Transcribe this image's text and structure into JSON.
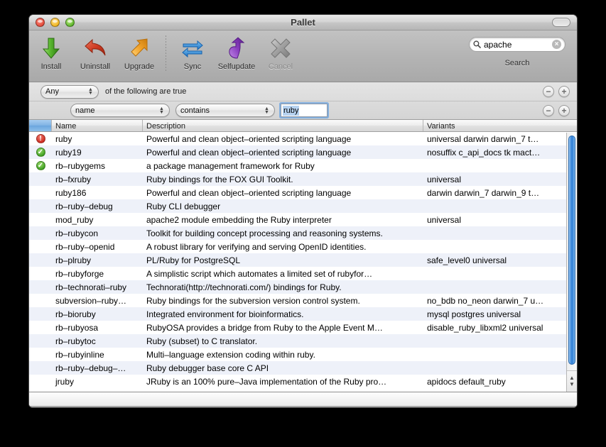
{
  "window": {
    "title": "Pallet",
    "traffic_lights": [
      "close",
      "minimize",
      "zoom"
    ],
    "toolbar_toggle": "toolbar-toggle-button"
  },
  "toolbar": {
    "items": [
      {
        "label": "Install",
        "icon": "down-arrow-icon",
        "enabled": true
      },
      {
        "label": "Uninstall",
        "icon": "back-arrow-icon",
        "enabled": true
      },
      {
        "label": "Upgrade",
        "icon": "up-arrow-icon",
        "enabled": true
      },
      {
        "label": "Sync",
        "icon": "sync-arrows-icon",
        "enabled": true
      },
      {
        "label": "Selfupdate",
        "icon": "curved-up-arrow-icon",
        "enabled": true
      },
      {
        "label": "Cancel",
        "icon": "x-cross-icon",
        "enabled": false
      }
    ],
    "search": {
      "value": "apache",
      "placeholder": "Search",
      "label": "Search",
      "icon": "search-icon",
      "clear_icon": "clear-icon"
    }
  },
  "filters": {
    "match_popup": "Any",
    "caption": "of the following are true",
    "rules": [
      {
        "field": "name",
        "operator": "contains",
        "value": "ruby"
      }
    ],
    "remove_label": "−",
    "add_label": "+"
  },
  "table": {
    "columns": [
      {
        "key": "status",
        "label": ""
      },
      {
        "key": "name",
        "label": "Name"
      },
      {
        "key": "description",
        "label": "Description"
      },
      {
        "key": "variants",
        "label": "Variants"
      }
    ],
    "rows": [
      {
        "status": "error",
        "name": "ruby",
        "description": "Powerful and clean object–oriented scripting language",
        "variants": "universal darwin darwin_7 t…"
      },
      {
        "status": "ok",
        "name": "ruby19",
        "description": "Powerful and clean object–oriented scripting language",
        "variants": "nosuffix c_api_docs tk mact…"
      },
      {
        "status": "ok",
        "name": "rb–rubygems",
        "description": "a package management framework for Ruby",
        "variants": ""
      },
      {
        "status": "",
        "name": "rb–fxruby",
        "description": "Ruby bindings for the FOX GUI Toolkit.",
        "variants": "universal"
      },
      {
        "status": "",
        "name": "ruby186",
        "description": "Powerful and clean object–oriented scripting language",
        "variants": "darwin darwin_7 darwin_9 t…"
      },
      {
        "status": "",
        "name": "rb–ruby–debug",
        "description": "Ruby CLI debugger",
        "variants": ""
      },
      {
        "status": "",
        "name": "mod_ruby",
        "description": "apache2 module embedding the Ruby interpreter",
        "variants": "universal"
      },
      {
        "status": "",
        "name": "rb–rubycon",
        "description": "Toolkit for building concept processing and reasoning systems.",
        "variants": ""
      },
      {
        "status": "",
        "name": "rb–ruby–openid",
        "description": "A robust library for verifying and serving OpenID identities.",
        "variants": ""
      },
      {
        "status": "",
        "name": "rb–plruby",
        "description": "PL/Ruby for PostgreSQL",
        "variants": "safe_level0 universal"
      },
      {
        "status": "",
        "name": "rb–rubyforge",
        "description": "A simplistic script which automates a limited set of rubyfor…",
        "variants": ""
      },
      {
        "status": "",
        "name": "rb–technorati–ruby",
        "description": "Technorati(http://technorati.com/) bindings for Ruby.",
        "variants": ""
      },
      {
        "status": "",
        "name": "subversion–ruby…",
        "description": "Ruby bindings for the subversion version control system.",
        "variants": "no_bdb no_neon darwin_7 u…"
      },
      {
        "status": "",
        "name": "rb–bioruby",
        "description": "Integrated environment for bioinformatics.",
        "variants": "mysql postgres universal"
      },
      {
        "status": "",
        "name": "rb–rubyosa",
        "description": "RubyOSA provides a bridge from Ruby to the Apple Event M…",
        "variants": "disable_ruby_libxml2 universal"
      },
      {
        "status": "",
        "name": "rb–rubytoc",
        "description": "Ruby (subset) to C translator.",
        "variants": ""
      },
      {
        "status": "",
        "name": "rb–rubyinline",
        "description": "Multi–language extension coding within ruby.",
        "variants": ""
      },
      {
        "status": "",
        "name": "rb–ruby–debug–…",
        "description": "Ruby debugger base core C API",
        "variants": ""
      },
      {
        "status": "",
        "name": "jruby",
        "description": "JRuby is an 100% pure–Java implementation of the Ruby pro…",
        "variants": "apidocs default_ruby"
      }
    ]
  },
  "scrollbar": {
    "up_arrow": "▲",
    "down_arrow": "▼"
  },
  "colors": {
    "selected_column_header": "#7fb2e4",
    "row_stripe": "#eef1f9",
    "scroll_thumb": "#2f7fd6",
    "status_error": "#cc2a20",
    "status_ok": "#3d9e1f",
    "focus_ring": "#76a8de"
  }
}
